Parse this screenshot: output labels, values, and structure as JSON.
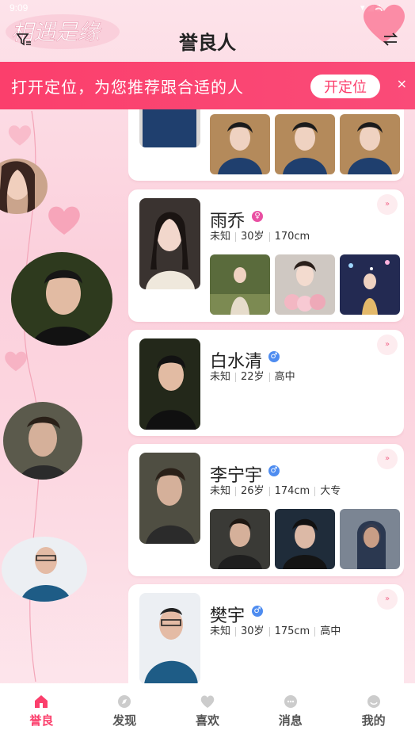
{
  "status_bar": {
    "time": "9:09"
  },
  "header": {
    "title": "誉良人",
    "logo_text": "相遇是缘"
  },
  "location_banner": {
    "text": "打开定位，为您推荐跟合适的人",
    "button_label": "开定位",
    "close_label": "×"
  },
  "cards": [
    {
      "name": "",
      "gender": "",
      "info": []
    },
    {
      "name": "雨乔",
      "gender": "female",
      "gender_symbol": "♀",
      "info": [
        "未知",
        "30岁",
        "170cm"
      ]
    },
    {
      "name": "白水清",
      "gender": "male",
      "gender_symbol": "♂",
      "info": [
        "未知",
        "22岁",
        "高中"
      ]
    },
    {
      "name": "李宁宇",
      "gender": "male",
      "gender_symbol": "♂",
      "info": [
        "未知",
        "26岁",
        "174cm",
        "大专"
      ]
    },
    {
      "name": "樊宇",
      "gender": "male",
      "gender_symbol": "♂",
      "info": [
        "未知",
        "30岁",
        "175cm",
        "高中"
      ]
    }
  ],
  "like_label": "»",
  "nav": [
    {
      "label": "誉良",
      "icon": "home-icon",
      "active": true
    },
    {
      "label": "发现",
      "icon": "discover-icon",
      "active": false
    },
    {
      "label": "喜欢",
      "icon": "heart-icon",
      "active": false
    },
    {
      "label": "消息",
      "icon": "message-icon",
      "active": false
    },
    {
      "label": "我的",
      "icon": "profile-icon",
      "active": false
    }
  ],
  "colors": {
    "accent": "#fb3f6c",
    "male": "#4e8cf0",
    "female": "#e94fa2"
  }
}
